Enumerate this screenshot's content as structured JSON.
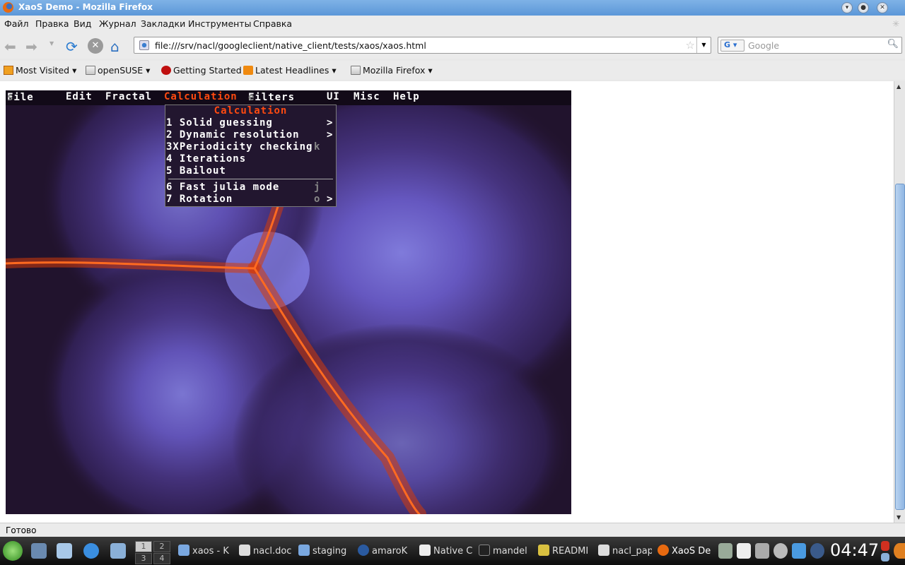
{
  "window": {
    "title": "XaoS Demo - Mozilla Firefox"
  },
  "menubar": [
    "Файл",
    "Правка",
    "Вид",
    "Журнал",
    "Закладки",
    "Инструменты",
    "Справка"
  ],
  "navbar": {
    "url": "file:///srv/nacl/googleclient/native_client/tests/xaos/xaos.html",
    "search_placeholder": "Google",
    "search_engine": "G"
  },
  "bookmarks": [
    "Most Visited",
    "openSUSE",
    "Getting Started",
    "Latest Headlines",
    "Mozilla Firefox"
  ],
  "xaos": {
    "menu": {
      "files": "File",
      "files_hint": "s",
      "edit": "Edit",
      "fractal": "Fractal",
      "calculation": "Calculation",
      "filters": "Filters",
      "filters_hint": "e",
      "ui": "UI",
      "misc": "Misc",
      "help": "Help"
    },
    "dropdown": {
      "title": "Calculation",
      "items": [
        {
          "label": "1 Solid guessing",
          "arrow": ">"
        },
        {
          "label": "2 Dynamic resolution",
          "arrow": ">"
        },
        {
          "label": "3XPeriodicity checking",
          "key": "k"
        },
        {
          "label": "4 Iterations"
        },
        {
          "label": "5 Bailout"
        },
        {
          "label": "6 Fast julia mode",
          "key": "j"
        },
        {
          "label": "7 Rotation",
          "key": "o",
          "arrow": ">"
        }
      ]
    },
    "accent": "#ff4a10"
  },
  "status": {
    "text": "Готово"
  },
  "taskbar": {
    "pager": [
      "1",
      "2",
      "3",
      "4"
    ],
    "tasks": [
      "xaos - K",
      "nacl.doc",
      "staging",
      "amaroK",
      "Native C",
      "mandel",
      "READMI",
      "nacl_pap",
      "XaoS De"
    ],
    "clock": "04:47"
  }
}
